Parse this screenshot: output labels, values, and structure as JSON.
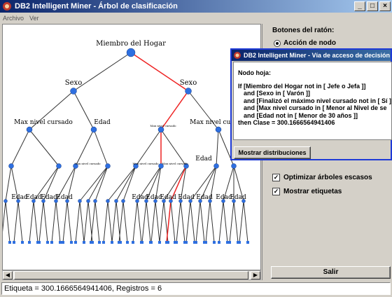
{
  "window": {
    "title": "DB2 Intelligent Miner - Árbol de clasificación",
    "min": "_",
    "max": "□",
    "close": "×"
  },
  "menu": [
    {
      "label": "Archivo"
    },
    {
      "label": "Ver"
    }
  ],
  "tree": {
    "root": "Miembro del Hogar",
    "level1": [
      "Sexo",
      "Sexo"
    ],
    "level2": [
      "Max nivel cursado",
      "Edad",
      "",
      "Max nivel cursado"
    ],
    "small_labels": [
      "Max nivel cursado",
      "Max nivel cursado",
      "Max nivel cursado",
      "Max nivel cursado",
      "Edad"
    ],
    "edad_label": "Edad",
    "edad_leaf_labels": [
      "Edad",
      "Edad",
      "Edad",
      "Edad",
      "Edad",
      "Edad",
      "Edad",
      "Edad",
      "Edad",
      "Edad",
      "Edad",
      "Edad"
    ]
  },
  "colors": {
    "path": "#ee2222",
    "node": "#2e6fe0",
    "edge": "#333333"
  },
  "right_panel": {
    "heading": "Botones del ratón:",
    "radio_label": "Acción de nodo",
    "checkbox1": "Optimizar árboles escasos",
    "checkbox2": "Mostrar etiquetas",
    "exit_button": "Salir"
  },
  "dialog": {
    "title": "DB2 Intelligent Miner - Vía de acceso de decisión",
    "heading": "Nodo hoja:",
    "lines": [
      "If [Miembro del Hogar not in [ Jefe o Jefa ]]",
      "and [Sexo in [ Varón ]]",
      "and [Finalizó el máximo nivel cursado not in [ Sí ]",
      "and [Max nivel cursado in [ Menor al Nivel de se",
      "and [Edad not in [ Menor de 30 años ]]",
      "then Clase = 300.1666564941406"
    ],
    "button": "Mostrar distribuciones"
  },
  "status": {
    "text": "Etiqueta = 300.1666564941406, Registros = 6"
  }
}
